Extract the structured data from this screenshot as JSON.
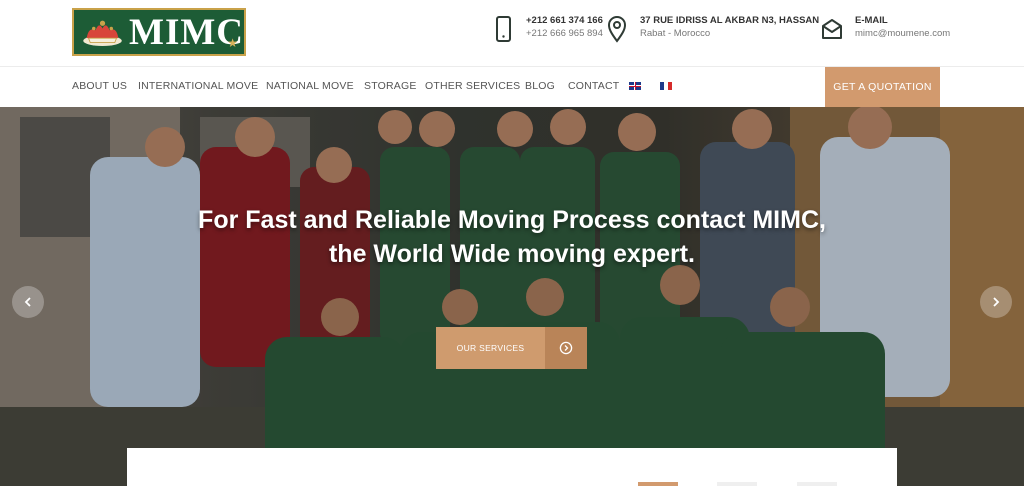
{
  "brand": {
    "logo_text": "MIMC"
  },
  "contacts": {
    "phone": {
      "icon": "phone-icon",
      "line1": "+212 661 374 166",
      "line2": "+212 666 965 894"
    },
    "address": {
      "icon": "map-pin-icon",
      "line1": "37 RUE IDRISS AL AKBAR N3, HASSAN",
      "line2": "Rabat - Morocco"
    },
    "email": {
      "icon": "envelope-icon",
      "line1": "E-MAIL",
      "line2": "mimc@moumene.com"
    }
  },
  "nav": {
    "items": [
      {
        "label": "ABOUT US"
      },
      {
        "label": "INTERNATIONAL MOVE"
      },
      {
        "label": "NATIONAL MOVE"
      },
      {
        "label": "STORAGE"
      },
      {
        "label": "OTHER SERVICES"
      },
      {
        "label": "BLOG"
      },
      {
        "label": "CONTACT"
      }
    ],
    "languages": [
      "english-flag-icon",
      "french-flag-icon"
    ],
    "cta_label": "GET A QUOTATION"
  },
  "hero": {
    "title_line1": "For Fast and Reliable Moving Process contact MIMC,",
    "title_line2": "the World Wide moving expert.",
    "button_label": "OUR SERVICES",
    "button_icon": "circle-arrow-right-icon",
    "prev_icon": "chevron-left-icon",
    "next_icon": "chevron-right-icon"
  },
  "colors": {
    "brand_green": "#1d5c36",
    "accent": "#d29a6e",
    "accent_dark": "#b98458",
    "logo_gold": "#c9a24a"
  }
}
